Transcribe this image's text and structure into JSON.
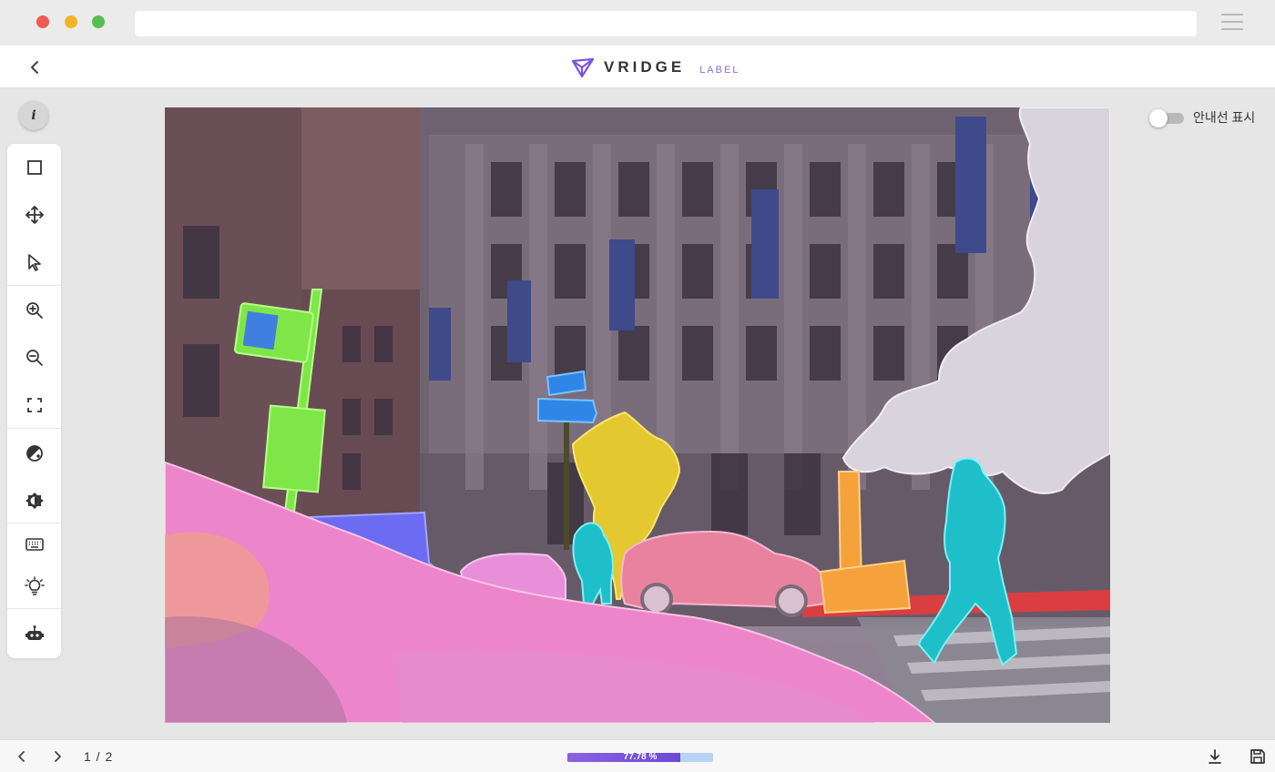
{
  "app": {
    "brand": "VRIDGE",
    "brand_sub": "LABEL"
  },
  "header": {
    "back_icon": "chevron-left-icon"
  },
  "sidebar": {
    "info_label": "i",
    "tools": [
      {
        "id": "bounding-box-tool",
        "icon": "square-icon"
      },
      {
        "id": "move-tool",
        "icon": "move-arrows-icon"
      },
      {
        "id": "select-tool",
        "icon": "cursor-pointer-icon"
      },
      {
        "id": "zoom-in-tool",
        "icon": "zoom-in-icon"
      },
      {
        "id": "zoom-out-tool",
        "icon": "zoom-out-icon"
      },
      {
        "id": "fit-screen-tool",
        "icon": "fullscreen-icon"
      },
      {
        "id": "contrast-tool",
        "icon": "contrast-icon"
      },
      {
        "id": "brightness-tool",
        "icon": "brightness-icon"
      },
      {
        "id": "keyboard-shortcuts-tool",
        "icon": "keyboard-icon"
      },
      {
        "id": "hint-tool",
        "icon": "lightbulb-icon"
      },
      {
        "id": "auto-label-tool",
        "icon": "robot-icon"
      }
    ]
  },
  "guide": {
    "label": "안내선 표시",
    "enabled": false
  },
  "footer": {
    "page_indicator": "1 / 2",
    "progress_percent": 77.78,
    "progress_label": "77.78 %"
  },
  "colors": {
    "accent": "#7b55dc",
    "progress_track": "#b9d4f3"
  },
  "annotations": [
    {
      "class": "car",
      "color": "#ee7bd8"
    },
    {
      "class": "truck",
      "color": "#6c6cf2"
    },
    {
      "class": "traffic-sign",
      "color": "#2f86e6"
    },
    {
      "class": "traffic-light",
      "color": "#7ee646"
    },
    {
      "class": "pole",
      "color": "#7ee646"
    },
    {
      "class": "vegetation",
      "color": "#e3c82f"
    },
    {
      "class": "pedestrian",
      "color": "#1fbfc9"
    },
    {
      "class": "traffic-cone",
      "color": "#f5a23c"
    },
    {
      "class": "road-marking",
      "color": "#ef3a3a"
    },
    {
      "class": "smoke",
      "color": "#d8d3dd"
    }
  ]
}
